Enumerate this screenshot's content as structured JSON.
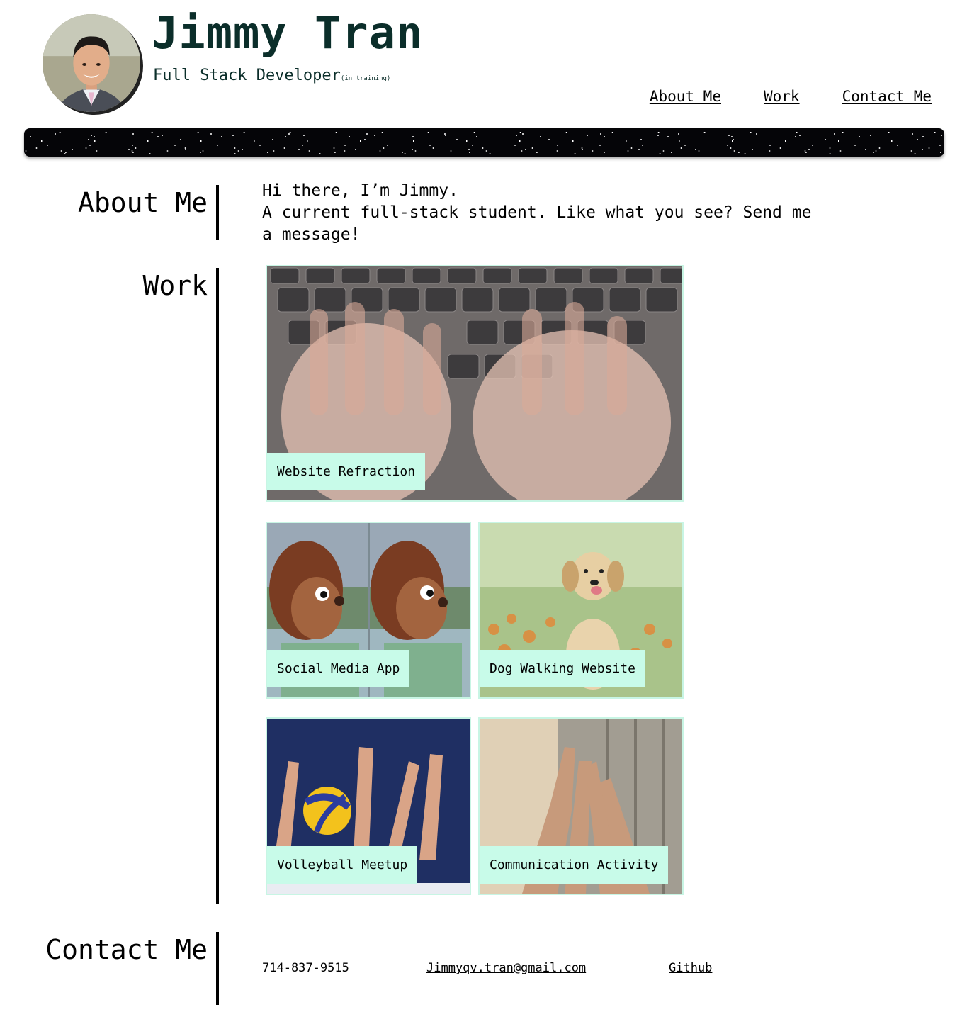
{
  "header": {
    "name": "Jimmy Tran",
    "subtitle": "Full Stack Developer",
    "subtitle_note": "(in training)"
  },
  "nav": {
    "items": [
      "About Me",
      "Work",
      "Contact Me"
    ]
  },
  "about": {
    "heading": "About Me",
    "line1": "Hi there, I’m Jimmy.",
    "line2": "A current full-stack student. Like what you see? Send me a message!"
  },
  "work": {
    "heading": "Work",
    "projects": [
      {
        "title": "Website Refraction",
        "image": "typing-hands-keyboard"
      },
      {
        "title": "Social Media App",
        "image": "puppet-monkey"
      },
      {
        "title": "Dog Walking Website",
        "image": "golden-puppy"
      },
      {
        "title": "Volleyball Meetup",
        "image": "volleyball-hands"
      },
      {
        "title": "Communication Activity",
        "image": "team-high-five"
      }
    ]
  },
  "contact": {
    "heading": "Contact Me",
    "phone": "714-837-9515",
    "email": "Jimmyqv.tran@gmail.com",
    "github": "Github"
  },
  "colors": {
    "name_color": "#0b2e2a",
    "label_bg": "#c8fbe9",
    "card_border": "#c8f5e4"
  }
}
